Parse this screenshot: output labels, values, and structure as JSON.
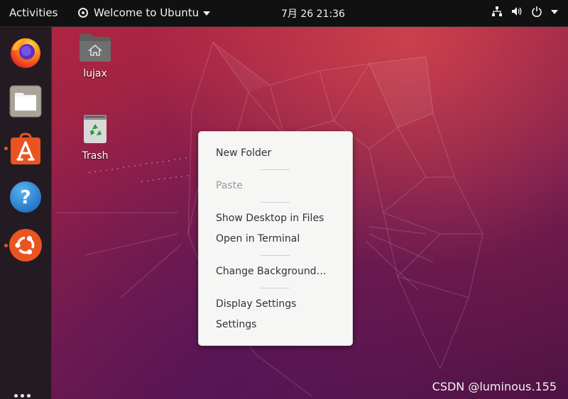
{
  "topbar": {
    "activities_label": "Activities",
    "app_menu_label": "Welcome to Ubuntu",
    "clock": "7月 26  21:36",
    "tray_icons": [
      "network-icon",
      "volume-icon",
      "power-icon",
      "chevron-down-icon"
    ]
  },
  "dock": {
    "items": [
      {
        "name": "firefox",
        "running": false
      },
      {
        "name": "files",
        "running": false
      },
      {
        "name": "ubuntu-software",
        "running": true
      },
      {
        "name": "help",
        "running": false
      },
      {
        "name": "ubuntu-welcome",
        "running": true
      }
    ]
  },
  "desktop": {
    "icons": [
      {
        "label": "lujax",
        "icon": "home-folder-icon"
      },
      {
        "label": "Trash",
        "icon": "trash-icon"
      }
    ]
  },
  "context_menu": {
    "new_folder": "New Folder",
    "paste": "Paste",
    "show_desktop_in_files": "Show Desktop in Files",
    "open_in_terminal": "Open in Terminal",
    "change_background": "Change Background…",
    "display_settings": "Display Settings",
    "settings": "Settings"
  },
  "watermark": "CSDN @luminous.155",
  "colors": {
    "accent": "#e95420",
    "topbar": "#111111",
    "dock": "#241b22",
    "menu_bg": "#f6f6f5"
  }
}
